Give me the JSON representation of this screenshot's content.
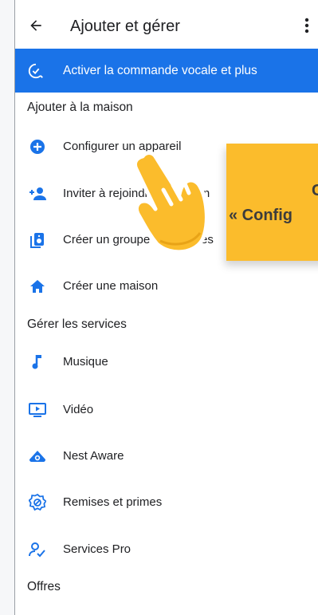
{
  "header": {
    "title": "Ajouter et gérer",
    "back_icon": "arrow-left-icon",
    "more_icon": "more-vert-icon"
  },
  "banner": {
    "label": "Activer la commande vocale et plus",
    "icon": "voice-check-icon",
    "color": "#1a73e8"
  },
  "sections": {
    "add": "Ajouter à la maison",
    "manage": "Gérer les services",
    "offers": "Offres"
  },
  "add_items": [
    {
      "label": "Configurer un appareil",
      "icon": "add-circle-icon"
    },
    {
      "label": "Inviter à rejoindre la maison",
      "icon": "person-add-icon"
    },
    {
      "label": "Créer un groupe d'enceintes",
      "icon": "speaker-group-icon"
    },
    {
      "label": "Créer une maison",
      "icon": "home-icon"
    }
  ],
  "service_items": [
    {
      "label": "Musique",
      "icon": "music-note-icon"
    },
    {
      "label": "Vidéo",
      "icon": "video-icon"
    },
    {
      "label": "Nest Aware",
      "icon": "nest-aware-icon"
    },
    {
      "label": "Remises et primes",
      "icon": "offer-badge-icon"
    },
    {
      "label": "Services Pro",
      "icon": "pro-services-icon"
    }
  ],
  "overlay": {
    "line1": "C",
    "line2": "« Config",
    "tooltip_color": "#fbbc2c",
    "pointer_icon": "pointing-hand-icon"
  },
  "accent": "#1a73e8"
}
